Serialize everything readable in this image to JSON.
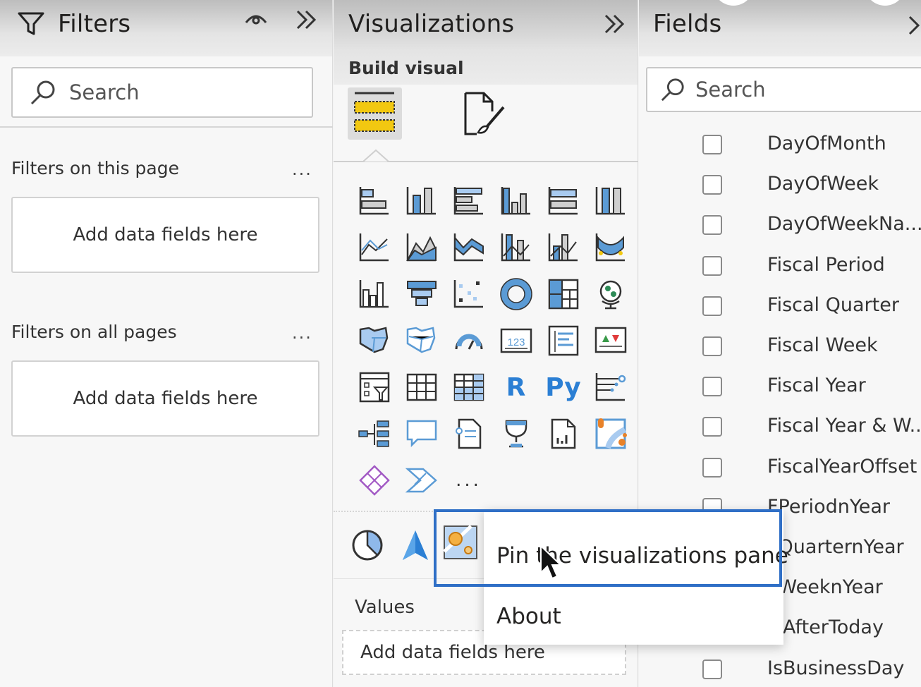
{
  "filters": {
    "title": "Filters",
    "search_placeholder": "Search",
    "this_page_label": "Filters on this page",
    "all_pages_label": "Filters on all pages",
    "more_label": "...",
    "drop_label": "Add data fields here"
  },
  "visualizations": {
    "title": "Visualizations",
    "build_visual_label": "Build visual",
    "tabs": [
      {
        "name": "build-visual",
        "icon": "fields-well-icon",
        "selected": true
      },
      {
        "name": "format-visual",
        "icon": "format-paintbrush-icon",
        "selected": false
      }
    ],
    "grid_icons": [
      "stacked-bar-chart-icon",
      "stacked-column-chart-icon",
      "clustered-bar-chart-icon",
      "clustered-column-chart-icon",
      "100-stacked-bar-chart-icon",
      "100-stacked-column-chart-icon",
      "line-chart-icon",
      "area-chart-icon",
      "stacked-area-chart-icon",
      "line-and-stacked-column-icon",
      "line-and-clustered-column-icon",
      "ribbon-chart-icon",
      "waterfall-chart-icon",
      "funnel-icon",
      "scatter-chart-icon",
      "donut-chart-icon",
      "treemap-icon",
      "map-icon",
      "filled-map-icon",
      "shape-map-icon",
      "gauge-icon",
      "card-icon",
      "multi-row-card-icon",
      "kpi-icon",
      "slicer-icon",
      "table-icon",
      "matrix-icon",
      "r-visual-icon",
      "python-visual-icon",
      "key-influencers-icon",
      "decomposition-tree-icon",
      "qa-icon",
      "smart-narrative-icon",
      "metrics-icon",
      "paginated-report-icon",
      "azure-map-icon",
      "power-apps-icon",
      "power-automate-icon",
      "more-visuals-icon"
    ],
    "r_label": "R",
    "py_label": "Py",
    "card_label": "123",
    "more_label": "...",
    "custom_icons": [
      "pie-chart-icon",
      "arcgis-icon",
      "custom-visual-icon"
    ],
    "values_label": "Values",
    "drop_label": "Add data fields here"
  },
  "context_menu": {
    "items": [
      "Pin the visualizations pane",
      "About"
    ]
  },
  "fields": {
    "title": "Fields",
    "search_placeholder": "Search",
    "items": [
      "DayOfMonth",
      "DayOfWeek",
      "DayOfWeekNa...",
      "Fiscal Period",
      "Fiscal Quarter",
      "Fiscal Week",
      "Fiscal Year",
      "Fiscal Year & W...",
      "FiscalYearOffset",
      "FPeriodnYear",
      "FQuarternYear",
      "FWeeknYear",
      "IsAfterToday",
      "IsBusinessDay"
    ]
  },
  "colors": {
    "accent": "#2f6fc6",
    "icon_blue": "#5b9bd5",
    "yellow": "#f2c811"
  }
}
